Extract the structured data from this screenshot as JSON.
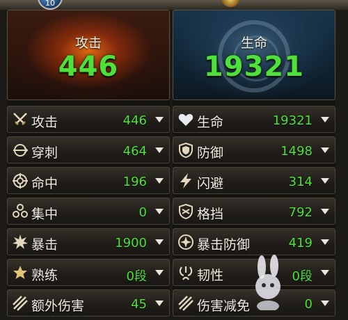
{
  "header": {
    "level": "10"
  },
  "attack_panel": {
    "title": "攻击",
    "value": "446",
    "stats": [
      {
        "icon": "crossed-swords-icon",
        "name": "攻击",
        "value": "446"
      },
      {
        "icon": "target-pierce-icon",
        "name": "穿刺",
        "value": "464"
      },
      {
        "icon": "crosshair-icon",
        "name": "命中",
        "value": "196"
      },
      {
        "icon": "three-dots-cluster-icon",
        "name": "集中",
        "value": "0"
      },
      {
        "icon": "burst-icon",
        "name": "暴击",
        "value": "1900"
      },
      {
        "icon": "star-icon",
        "name": "熟练",
        "value": "0段"
      },
      {
        "icon": "slash-icon",
        "name": "额外伤害",
        "value": "45"
      }
    ]
  },
  "life_panel": {
    "title": "生命",
    "value": "19321",
    "stats": [
      {
        "icon": "heart-icon",
        "name": "生命",
        "value": "19321"
      },
      {
        "icon": "shield-icon",
        "name": "防御",
        "value": "1498"
      },
      {
        "icon": "lightning-icon",
        "name": "闪避",
        "value": "314"
      },
      {
        "icon": "block-shield-icon",
        "name": "格挡",
        "value": "792"
      },
      {
        "icon": "crit-defense-icon",
        "name": "暴击防御",
        "value": "419"
      },
      {
        "icon": "swirl-icon",
        "name": "韧性",
        "value": "0段"
      },
      {
        "icon": "damage-reduction-icon",
        "name": "伤害减免",
        "value": "0"
      }
    ]
  },
  "colors": {
    "value_green": "#4fe03c",
    "label": "#f2eee4"
  }
}
